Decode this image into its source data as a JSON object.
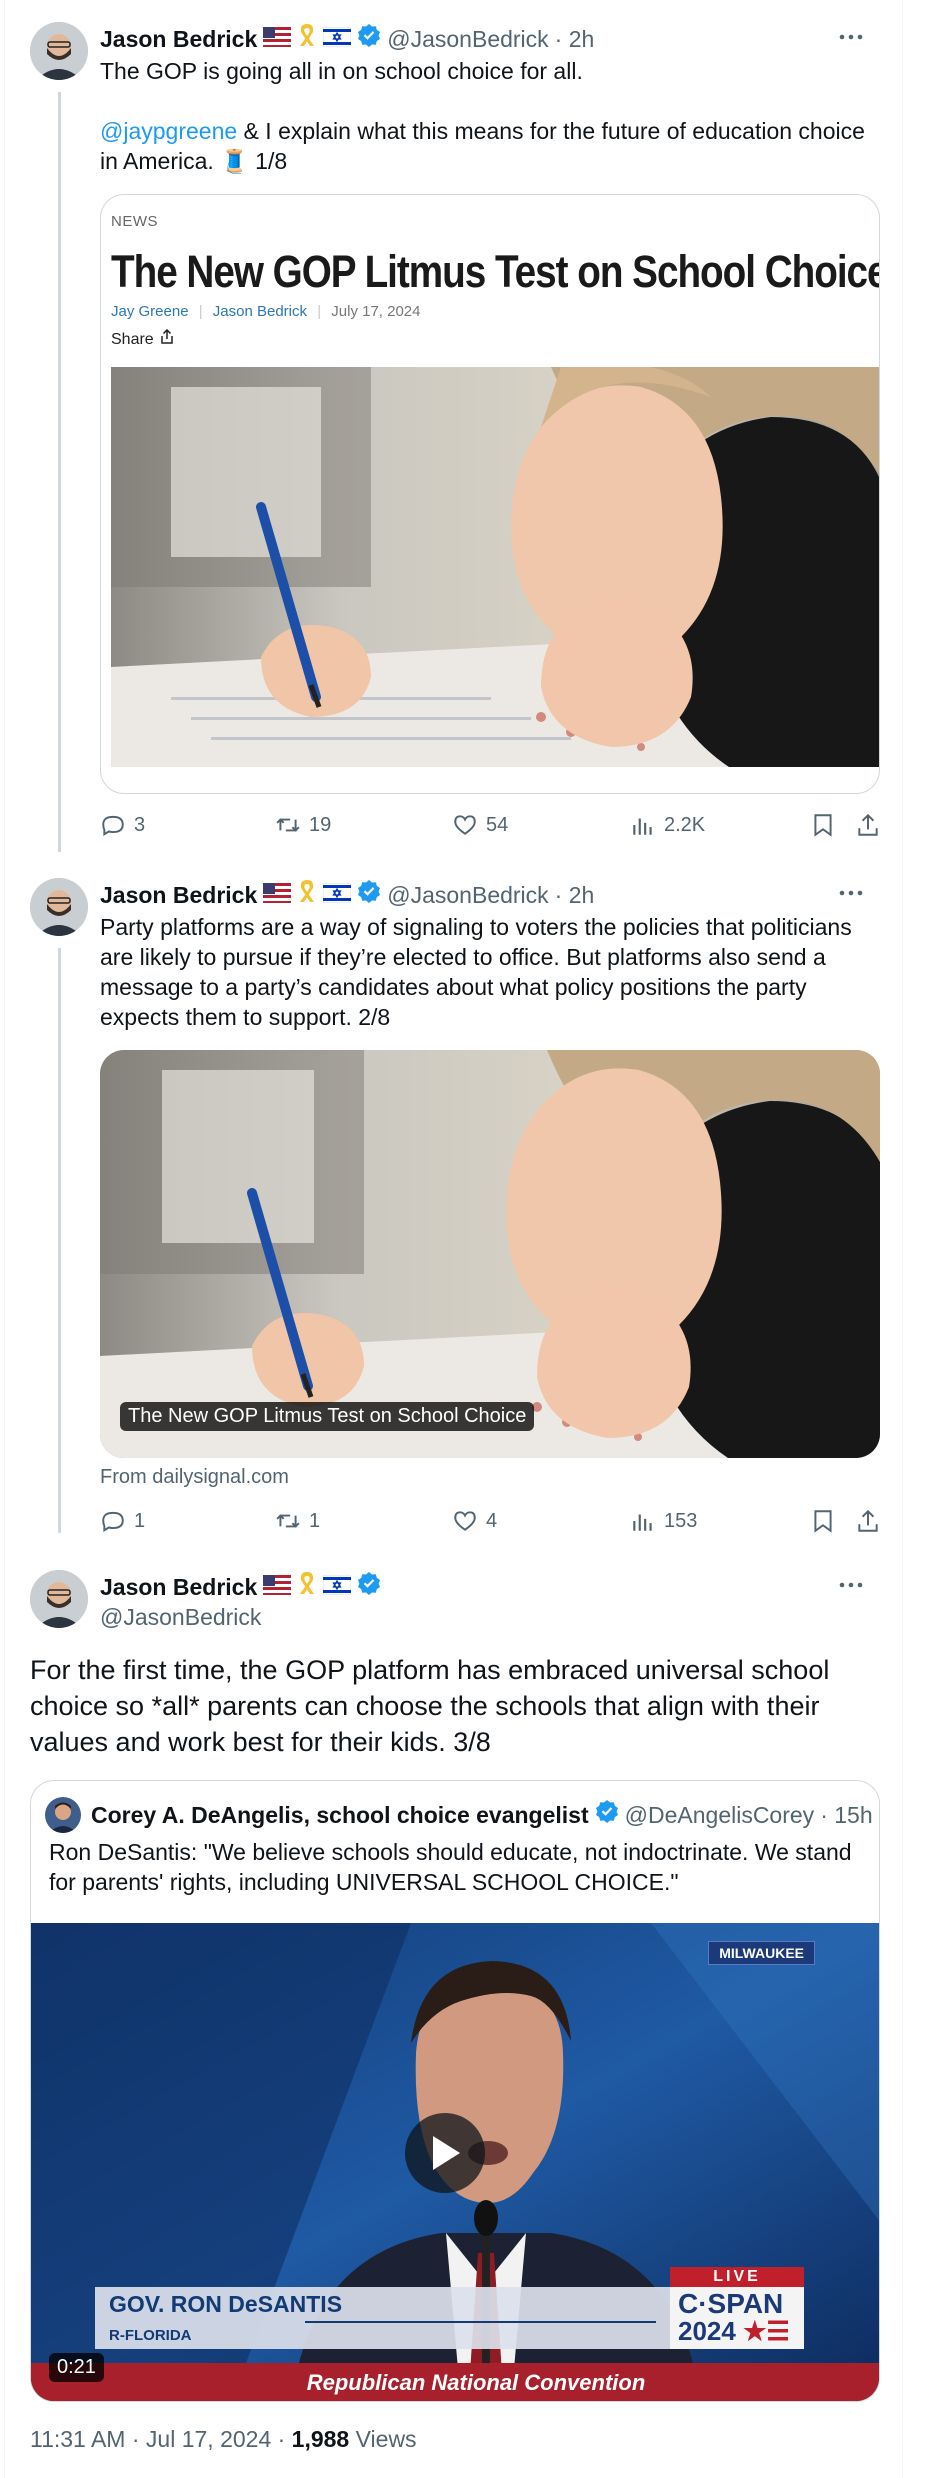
{
  "tweets": [
    {
      "name": "Jason Bedrick",
      "handle": "@JasonBedrick",
      "time": "· 2h",
      "text_line1": "The GOP is going all in on school choice for all.",
      "mention": "@jaypgreene",
      "text_line2_rest": " & I explain what this means for the future of education choice",
      "text_line3": "in America. 🧵 1/8",
      "card": {
        "section": "NEWS",
        "headline": "The New GOP Litmus Test on School Choice",
        "author1": "Jay Greene",
        "author2": "Jason Bedrick",
        "date": "July 17, 2024",
        "share": "Share"
      },
      "stats": {
        "replies": "3",
        "reposts": "19",
        "likes": "54",
        "views": "2.2K"
      }
    },
    {
      "name": "Jason Bedrick",
      "handle": "@JasonBedrick",
      "time": "· 2h",
      "lines": [
        "Party platforms are a way of signaling to voters the policies that politicians",
        "are likely to pursue if they’re elected to office. But platforms also send a",
        "message to a party’s candidates about what policy positions the party",
        "expects them to support. 2/8"
      ],
      "image_caption": "The New GOP Litmus Test on School Choice",
      "from": "From dailysignal.com",
      "stats": {
        "replies": "1",
        "reposts": "1",
        "likes": "4",
        "views": "153"
      }
    },
    {
      "name": "Jason Bedrick",
      "handle": "@JasonBedrick",
      "lines": [
        "For the first time, the GOP platform has embraced universal school",
        "choice so *all* parents can choose the schools that align with their",
        "values and work best for their kids. 3/8"
      ],
      "quote": {
        "name": "Corey A. DeAngelis, school choice evangelist",
        "handle": "@DeAngelisCorey",
        "time": "· 15h",
        "line1": "Ron DeSantis: \"We believe schools should educate, not indoctrinate. We stand",
        "line2": "for parents' rights, including UNIVERSAL SCHOOL CHOICE.\"",
        "video": {
          "location": "MILWAUKEE",
          "chyron_name": "GOV. RON DeSANTIS",
          "chyron_sub": "R-FLORIDA",
          "live": "LIVE",
          "network": "C·SPAN",
          "year": "2024",
          "banner": "Republican National Convention",
          "duration": "0:21"
        }
      },
      "timestamp": "11:31 AM · Jul 17, 2024 · ",
      "views_count": "1,988",
      "views_label": " Views"
    }
  ],
  "colors": {
    "accent": "#1d9bf0",
    "secondary": "#536471",
    "border": "#cfd9de"
  },
  "icons": [
    "reply-icon",
    "repost-icon",
    "like-icon",
    "views-icon",
    "bookmark-icon",
    "share-icon",
    "verified-icon",
    "more-icon",
    "play-icon",
    "share-box-icon"
  ]
}
